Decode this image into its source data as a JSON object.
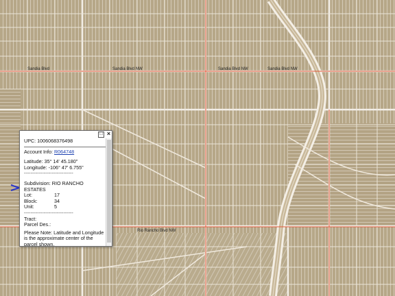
{
  "map": {
    "street_labels": [
      "Sandia Blvd",
      "Sandia Blvd NW",
      "Sandia Blvd NW",
      "Sandia Blvd NW",
      "Rio Rancho Blvd NW"
    ],
    "colors": {
      "background": "#b8a98c",
      "grid_line": "#f4f0ea",
      "road_line": "#e35a3a"
    }
  },
  "popup": {
    "upc": "UPC: 1006068376498",
    "account_label": "Account Info:",
    "account_value": "R064748",
    "latitude": "Latitude: 35° 14' 45.180\"",
    "longitude": "Longitude: -106° 47' 6.755\"",
    "separator": "------------------------------",
    "subdivision_line1": "Subdivision: RIO RANCHO",
    "subdivision_line2": "ESTATES",
    "lot_label": "Lot:",
    "lot_value": "17",
    "block_label": "Block:",
    "block_value": "34",
    "unit_label": "Unit:",
    "unit_value": "5",
    "tract": "Tract:",
    "parcel_des": "Parcel Des.:",
    "note": "Please Note: Latitude and Longitude is the approximate center of the parcel shown.",
    "maximize_icon": "maximize-icon",
    "close_icon": "close-icon"
  }
}
